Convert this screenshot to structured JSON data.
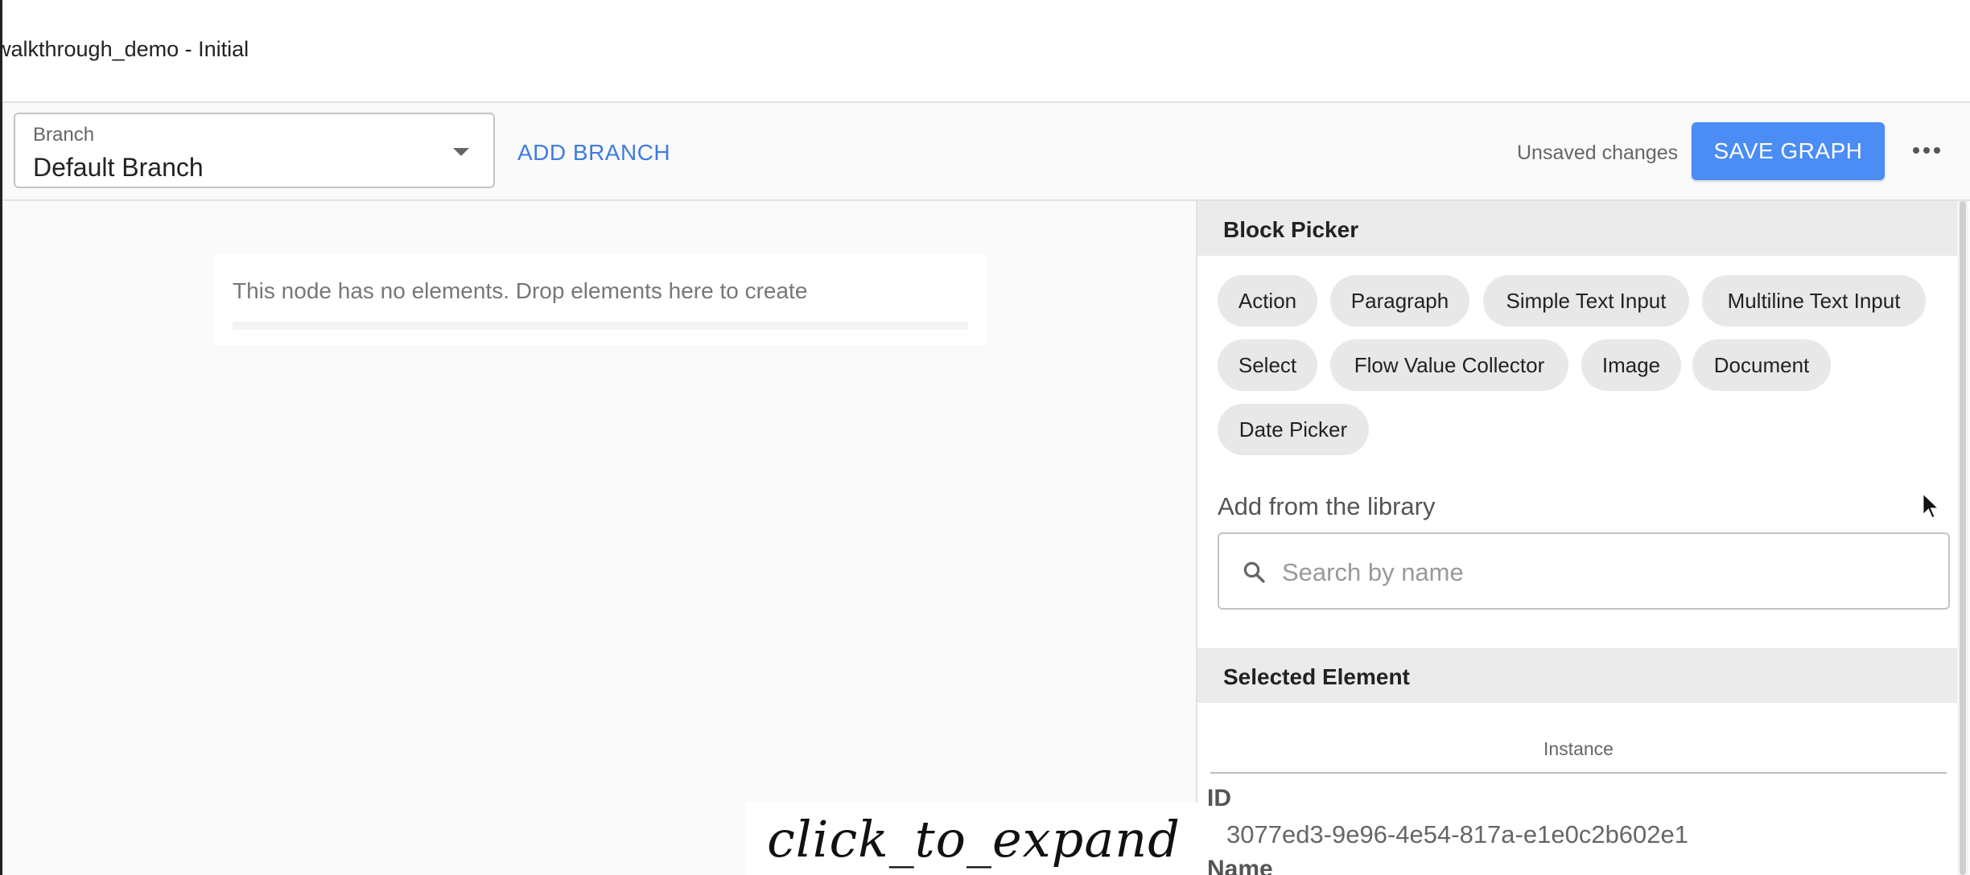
{
  "window": {
    "title": "walkthrough_demo - Initial"
  },
  "toolbar": {
    "branch_label": "Branch",
    "branch_value": "Default Branch",
    "add_branch": "ADD BRANCH",
    "unsaved": "Unsaved changes",
    "save_label": "SAVE GRAPH",
    "more_icon": "more-horizontal-icon"
  },
  "canvas": {
    "empty_message": "This node has no elements. Drop elements here to create"
  },
  "block_picker": {
    "title": "Block Picker",
    "chips": [
      "Action",
      "Paragraph",
      "Simple Text Input",
      "Multiline Text Input",
      "Select",
      "Flow Value Collector",
      "Image",
      "Document",
      "Date Picker"
    ],
    "library_label": "Add from the library",
    "search_placeholder": "Search by name"
  },
  "selected_element": {
    "title": "Selected Element",
    "tab": "Instance",
    "id_label": "ID",
    "id_value": "3077ed3-9e96-4e54-817a-e1e0c2b602e1",
    "name_label": "Name"
  },
  "overlay": {
    "text": "click_to_expand"
  },
  "colors": {
    "accent": "#4b8cf5",
    "link": "#3f7be0",
    "chip_bg": "#e8e8e8",
    "section_bg": "#ebebeb"
  }
}
